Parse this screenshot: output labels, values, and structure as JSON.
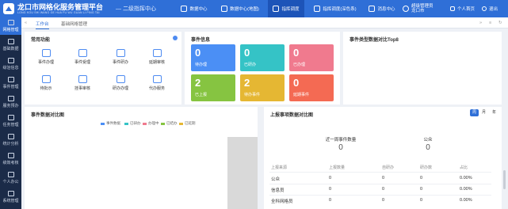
{
  "header": {
    "title": "龙口市网格化服务管理平台",
    "subtitle": "LONG KOU SHI WANG GE HUA FU WU GUAN LI PING TAI",
    "level_label": "— 二级指挥中心",
    "nav": [
      {
        "label": "数据中心"
      },
      {
        "label": "数据中心(地图)"
      },
      {
        "label": "指挥调度"
      },
      {
        "label": "指挥调度(深色系)"
      },
      {
        "label": "消息中心"
      }
    ],
    "user": {
      "name": "超级管理员",
      "org": "龙口市"
    },
    "links": [
      {
        "label": "个人首页"
      },
      {
        "label": "退出"
      }
    ]
  },
  "sidebar": {
    "items": [
      {
        "label": "网格管理"
      },
      {
        "label": "基础数据"
      },
      {
        "label": "综治信息"
      },
      {
        "label": "事件管理"
      },
      {
        "label": "服务预办"
      },
      {
        "label": "任务管理"
      },
      {
        "label": "统计分析"
      },
      {
        "label": "绩效考核"
      },
      {
        "label": "个人办公"
      },
      {
        "label": "系统管理"
      }
    ]
  },
  "tabs": [
    {
      "label": "工作台"
    },
    {
      "label": "基础网格管理"
    }
  ],
  "common_functions": {
    "title": "常用功能",
    "items": [
      {
        "label": "事件办理"
      },
      {
        "label": "事件受理"
      },
      {
        "label": "事件研办"
      },
      {
        "label": "延期审核"
      },
      {
        "label": "待批示"
      },
      {
        "label": "挂事审核"
      },
      {
        "label": "研办办理"
      },
      {
        "label": "代办服务"
      }
    ]
  },
  "event_info": {
    "title": "事件信息",
    "cards": [
      {
        "value": "0",
        "label": "待办理",
        "color": "#4b8ff5"
      },
      {
        "value": "0",
        "label": "已研办",
        "color": "#35c3c6"
      },
      {
        "value": "0",
        "label": "已办理",
        "color": "#f07a8e"
      },
      {
        "value": "2",
        "label": "已上报",
        "color": "#86c441"
      },
      {
        "value": "2",
        "label": "待办事件",
        "color": "#e5b733"
      },
      {
        "value": "0",
        "label": "延期事件",
        "color": "#f46a53"
      }
    ]
  },
  "event_type": {
    "title": "事件类型数据对比Top8"
  },
  "event_compare": {
    "title": "事件数据对比图",
    "legend": [
      {
        "label": "事件数据",
        "color": "#4b8ff5"
      },
      {
        "label": "已研办",
        "color": "#35c3c6"
      },
      {
        "label": "办理中",
        "color": "#f07a8e"
      },
      {
        "label": "已结办",
        "color": "#86c441"
      },
      {
        "label": "已延期",
        "color": "#e5b733"
      }
    ]
  },
  "report": {
    "title": "上报事项数据对比图",
    "periods": [
      {
        "label": "周"
      },
      {
        "label": "月"
      },
      {
        "label": "年"
      }
    ],
    "stats": [
      {
        "label": "近一周事件数量",
        "value": "0"
      },
      {
        "label": "公众",
        "value": "0"
      }
    ],
    "table": {
      "headers": [
        "上报来源",
        "上报数量",
        "自研办",
        "研办数",
        "占比"
      ],
      "rows": [
        [
          "公众",
          "0",
          "0",
          "0",
          "0.00%"
        ],
        [
          "信息员",
          "0",
          "0",
          "0",
          "0.00%"
        ],
        [
          "全科网格员",
          "0",
          "0",
          "0",
          "0.00%"
        ]
      ]
    }
  }
}
